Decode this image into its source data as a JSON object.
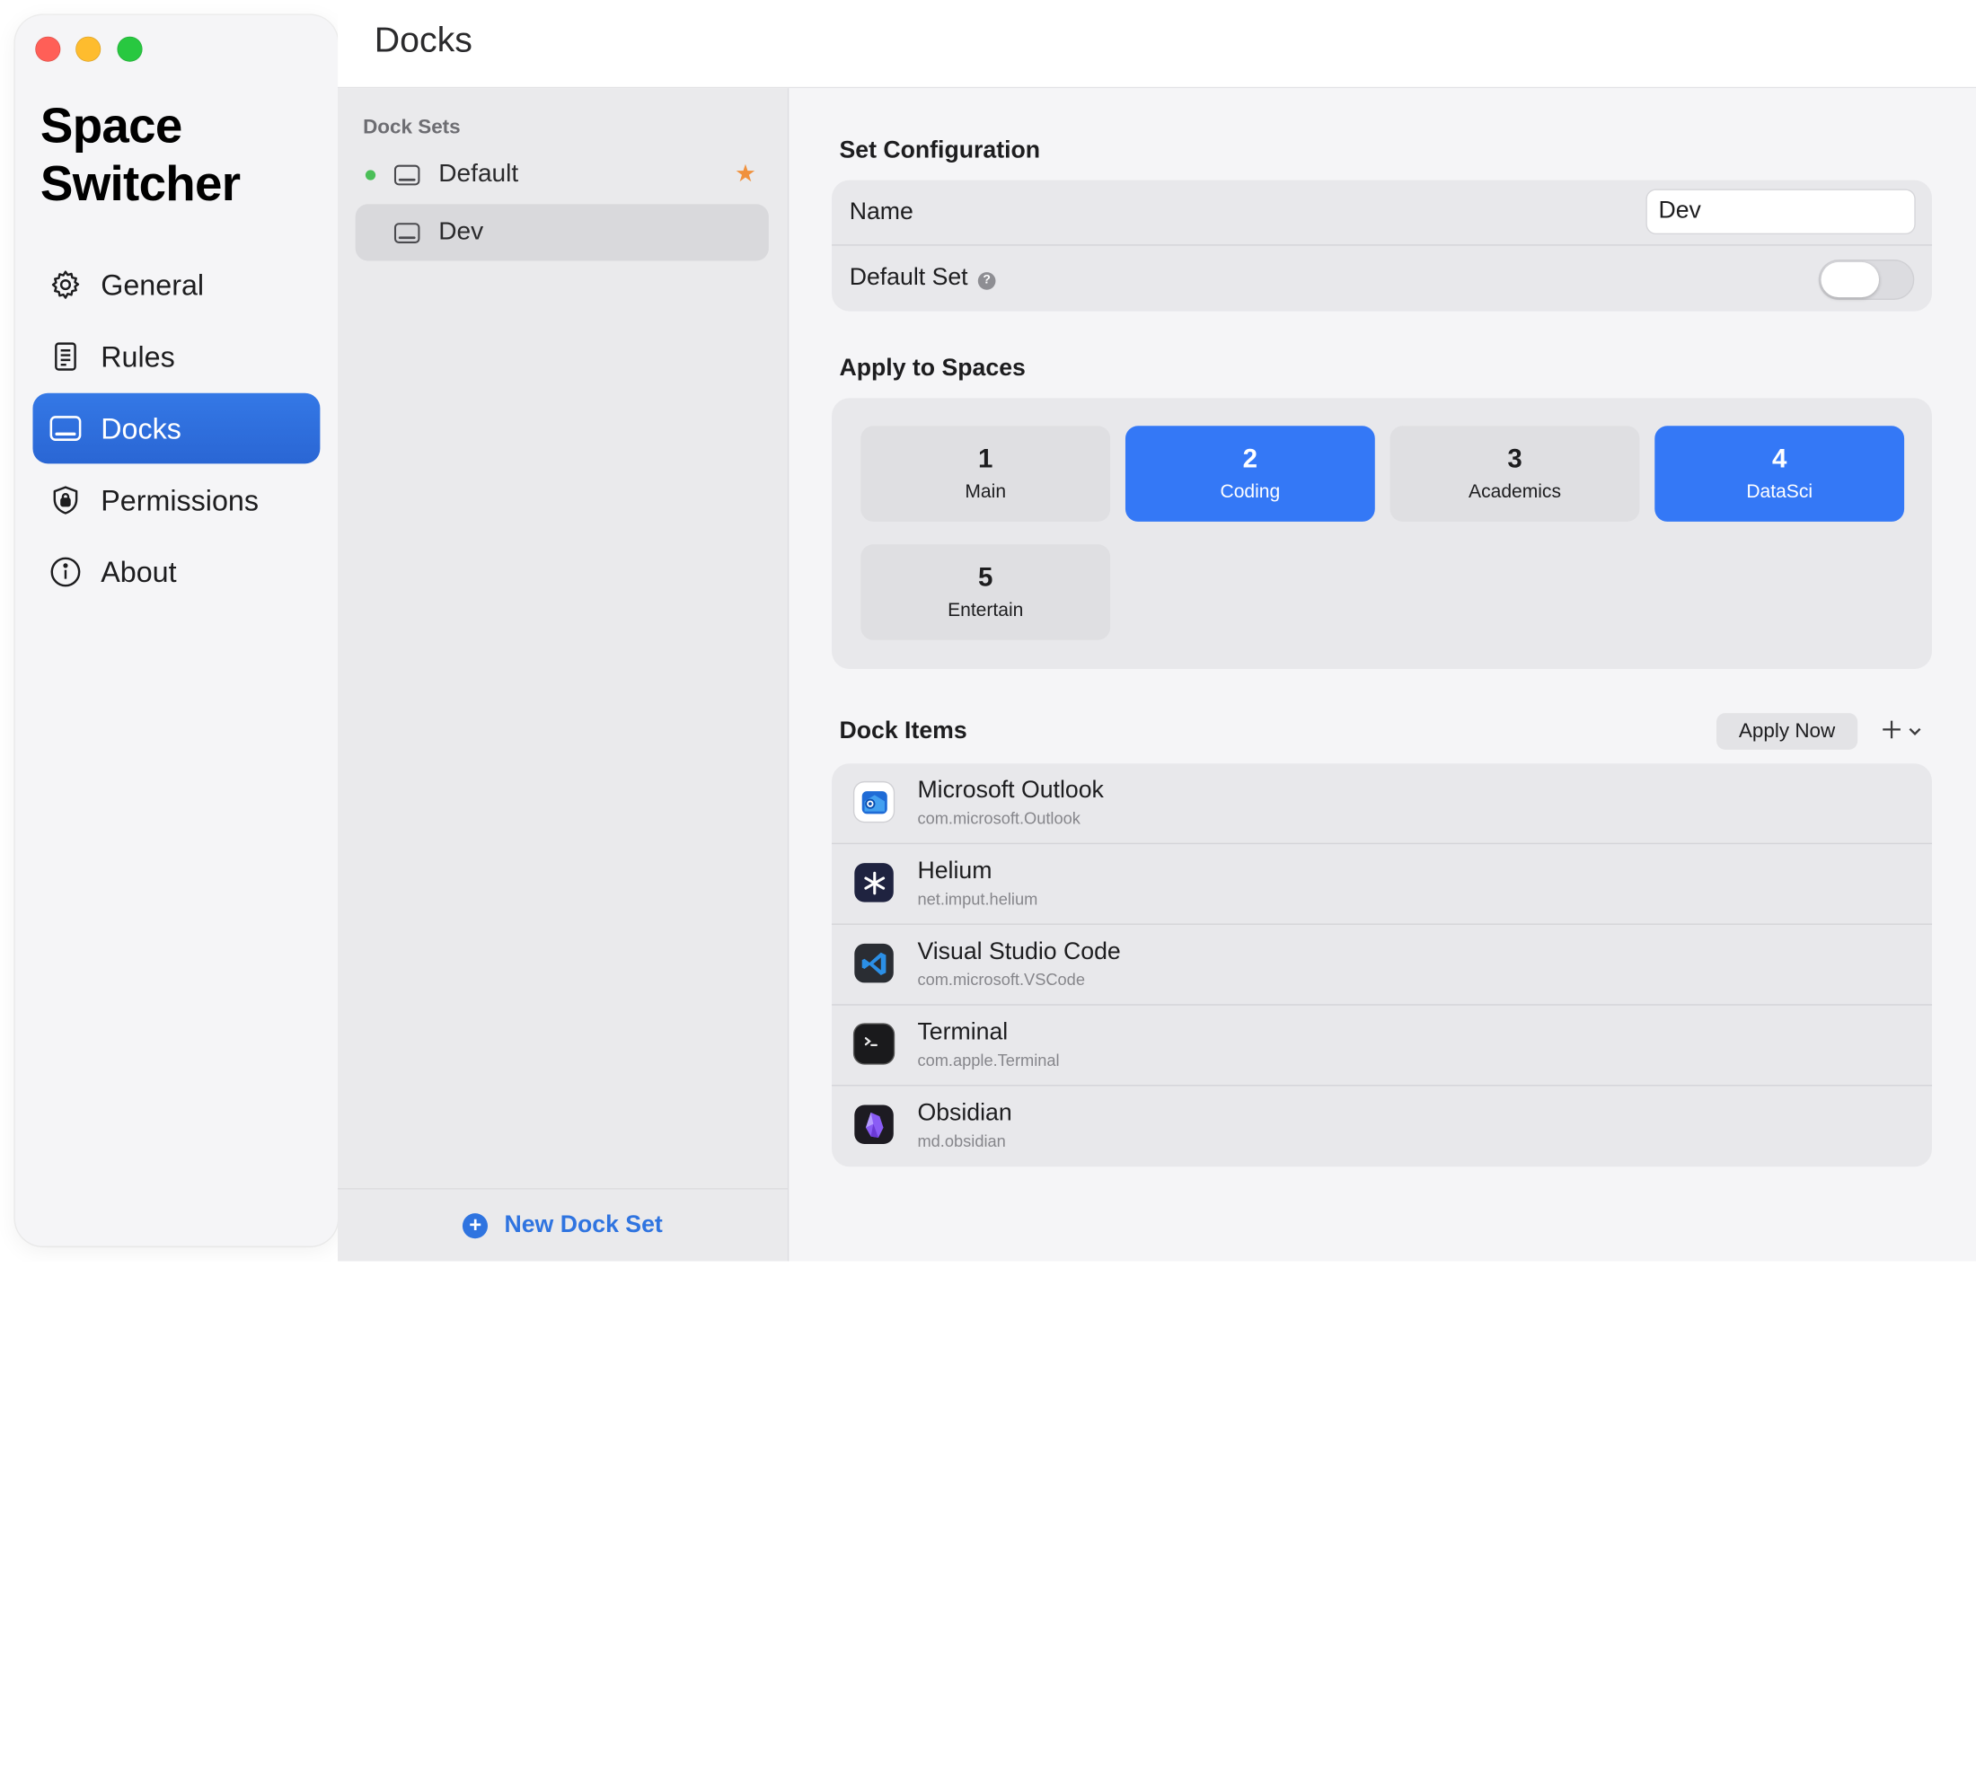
{
  "app": {
    "title_line1": "Space",
    "title_line2": "Switcher"
  },
  "sidebar": {
    "items": [
      {
        "label": "General",
        "icon": "gear-icon"
      },
      {
        "label": "Rules",
        "icon": "list-icon"
      },
      {
        "label": "Docks",
        "icon": "dock-icon",
        "active": true
      },
      {
        "label": "Permissions",
        "icon": "shield-lock-icon"
      },
      {
        "label": "About",
        "icon": "info-icon"
      }
    ]
  },
  "toolbar": {
    "title": "Docks"
  },
  "dock_sets": {
    "header": "Dock Sets",
    "items": [
      {
        "label": "Default",
        "active_dot": true,
        "is_default_star": true
      },
      {
        "label": "Dev",
        "selected": true
      }
    ],
    "new_button": "New Dock Set"
  },
  "config": {
    "section_title": "Set Configuration",
    "name_label": "Name",
    "name_value": "Dev",
    "default_label": "Default Set",
    "default_on": false
  },
  "spaces": {
    "section_title": "Apply to Spaces",
    "tiles": [
      {
        "num": "1",
        "name": "Main",
        "on": false
      },
      {
        "num": "2",
        "name": "Coding",
        "on": true
      },
      {
        "num": "3",
        "name": "Academics",
        "on": false
      },
      {
        "num": "4",
        "name": "DataSci",
        "on": true
      },
      {
        "num": "5",
        "name": "Entertain",
        "on": false
      }
    ]
  },
  "dock_items": {
    "section_title": "Dock Items",
    "apply_label": "Apply Now",
    "items": [
      {
        "name": "Microsoft Outlook",
        "bundle": "com.microsoft.Outlook",
        "icon": "outlook-icon"
      },
      {
        "name": "Helium",
        "bundle": "net.imput.helium",
        "icon": "helium-icon"
      },
      {
        "name": "Visual Studio Code",
        "bundle": "com.microsoft.VSCode",
        "icon": "vscode-icon"
      },
      {
        "name": "Terminal",
        "bundle": "com.apple.Terminal",
        "icon": "terminal-icon"
      },
      {
        "name": "Obsidian",
        "bundle": "md.obsidian",
        "icon": "obsidian-icon"
      }
    ]
  },
  "colors": {
    "accent": "#3478f6",
    "sidebar_active": "#2b6ad9",
    "default_dot": "#4bbf58",
    "star": "#f0913d"
  }
}
